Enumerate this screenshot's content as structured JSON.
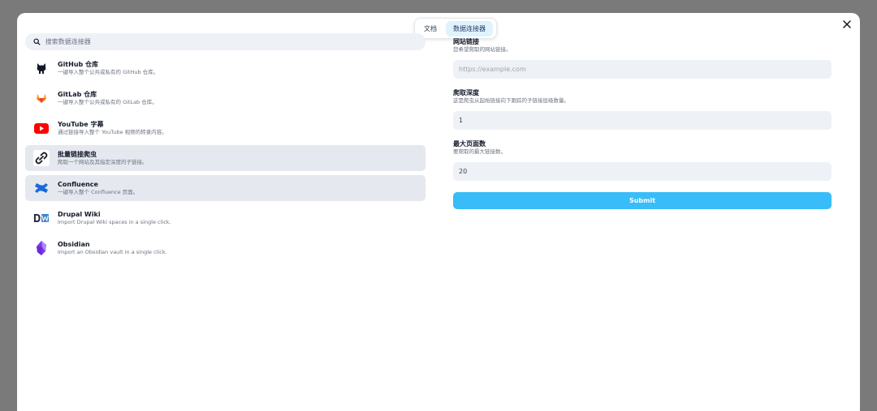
{
  "tabs": [
    {
      "label": "文档",
      "active": false
    },
    {
      "label": "数据连接器",
      "active": true
    }
  ],
  "search": {
    "placeholder": "搜索数据连接器"
  },
  "connectors": [
    {
      "name": "GitHub 仓库",
      "desc": "一键导入整个公共或私有的 GitHub 仓库。",
      "icon": "github-icon"
    },
    {
      "name": "GitLab 仓库",
      "desc": "一键导入整个公共或私有的 GitLab 仓库。",
      "icon": "gitlab-icon"
    },
    {
      "name": "YouTube 字幕",
      "desc": "通过链接导入整个 YouTube 视频的转录内容。",
      "icon": "youtube-icon"
    },
    {
      "name": "批量链接爬虫",
      "desc": "爬取一个网站及其指定深度的子链接。",
      "icon": "link-icon"
    },
    {
      "name": "Confluence",
      "desc": "一键导入整个 Confluence 页面。",
      "icon": "confluence-icon"
    },
    {
      "name": "Drupal Wiki",
      "desc": "Import Drupal Wiki spaces in a single click.",
      "icon": "drupal-wiki-icon"
    },
    {
      "name": "Obsidian",
      "desc": "Import an Obsidian vault in a single click.",
      "icon": "obsidian-icon"
    }
  ],
  "form": {
    "url_label": "网站链接",
    "url_hint": "您希望爬取的网站链接。",
    "url_placeholder": "https://example.com",
    "depth_label": "爬取深度",
    "depth_hint": "这是爬虫从起始链接向下跟踪的子链接层级数量。",
    "depth_value": "1",
    "max_label": "最大页面数",
    "max_hint": "要爬取的最大链接数。",
    "max_value": "20",
    "submit_label": "Submit"
  },
  "colors": {
    "accent": "#38bdf8",
    "selected_row": "#e5e8ee",
    "field_bg": "#eef2f7",
    "overlay": "#7a7a7a"
  }
}
